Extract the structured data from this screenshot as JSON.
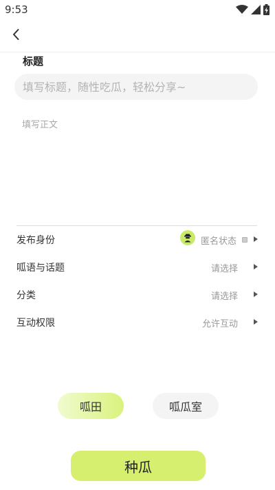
{
  "status_bar": {
    "time": "9:53",
    "icons": [
      "wifi-icon",
      "cell-signal-icon",
      "battery-charging-icon"
    ]
  },
  "header": {
    "back_icon": "chevron-left-icon"
  },
  "form": {
    "title_label": "标题",
    "title_placeholder": "填写标题，随性吃瓜，轻松分享~",
    "title_value": "",
    "body_placeholder": "填写正文",
    "body_value": ""
  },
  "options": [
    {
      "label": "发布身份",
      "value": "匿名状态",
      "icon": "anonymous-avatar-icon"
    },
    {
      "label": "呱语与话题",
      "value": "请选择"
    },
    {
      "label": "分类",
      "value": "请选择"
    },
    {
      "label": "互动权限",
      "value": "允许互动"
    }
  ],
  "destinations": {
    "selected": "呱田",
    "items": [
      "呱田",
      "呱瓜室"
    ]
  },
  "submit_label": "种瓜",
  "colors": {
    "accent": "#d6ef6f",
    "accent_light": "#f1fbcf",
    "avatar": "#c9ea6a"
  }
}
